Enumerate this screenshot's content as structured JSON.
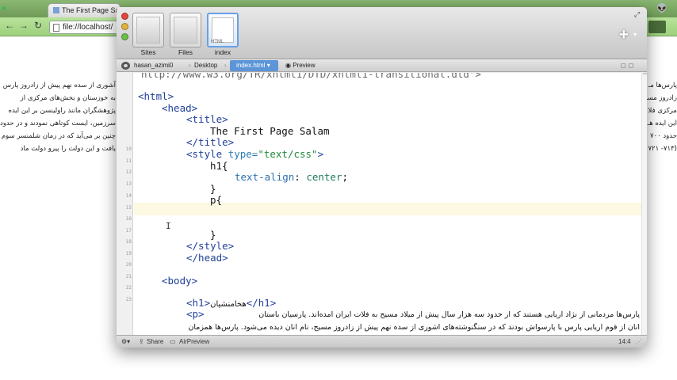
{
  "browser": {
    "tab_title": "The First Page Salam",
    "url": "file://localhost/",
    "back": "←",
    "forward": "→",
    "reload": "↻",
    "left_para": "آشوری از سده نهم پیش از زادروز پارس به خوزستان و بخش‌های مرکزی از پژوهشگران مانند راولینسن بر این ایده سرزمین، ایست کوتاهی نمودند و در حدود چنین بر می‌آید که در زمان شلمنسر سوم یافت و این دولت را پیرو دولت ماد",
    "right_para": "پارس‌ها مـ زادروز مسـ مرکزی فلا این ایده هـ حدود ۷۰۰ (۷۱۳- ۷۲۱ نمود."
  },
  "editor": {
    "projects": [
      {
        "label": "Sites"
      },
      {
        "label": "Files"
      },
      {
        "label": "index",
        "tag": "HTML"
      }
    ],
    "path": {
      "user": "hasan_azimi0",
      "desktop": "Desktop",
      "file": "index.html",
      "preview": "Preview"
    },
    "code": {
      "l1": "http://www.w3.org/TR/xhtml1/DTD/xhtml1-transitional.dtd\">",
      "l3": "<html>",
      "l4": "<head>",
      "l5": "<title>",
      "l6": "The First Page Salam",
      "l7": "</title>",
      "l8_tag": "<style ",
      "l8_attr": "type=",
      "l8_str": "\"text/css\"",
      "l8_end": ">",
      "l9": "h1{",
      "l10_prop": "text-align",
      "l10_colon": ": ",
      "l10_val": "center",
      "l10_semi": ";",
      "l12": "}",
      "l13": "p{",
      "l16": "}",
      "l17": "</style>",
      "l18": "</head>",
      "l20": "<body>",
      "l22_open": "<h1>",
      "l22_text": "هخامنشیان",
      "l22_close": "</h1>",
      "l23_open": "<p>",
      "l23_text": "پارس‌ها مردمانی از نژاد آریایی هستند که از حدود سه هزار سال پیش از میلاد مسیح به فلات ایران آمده‌اند. پارسیان باستان",
      "l24_text": "آنان از قوم آریایی پارس با پارسواش بودند که در سنگنوشته‌های آشوری از سده نهم پیش از زادروز مسیح، نام آنان دیده می‌شود. پارس‌ها همزمان"
    },
    "line_numbers": [
      "",
      "",
      "",
      "",
      "",
      "",
      "",
      "",
      "",
      "10",
      "11",
      "12",
      "13",
      "14",
      "15",
      "16",
      "17",
      "18",
      "19",
      "20",
      "21",
      "22",
      "23"
    ],
    "status": {
      "share": "Share",
      "airpreview": "AirPreview",
      "cursor": "14:4"
    }
  }
}
